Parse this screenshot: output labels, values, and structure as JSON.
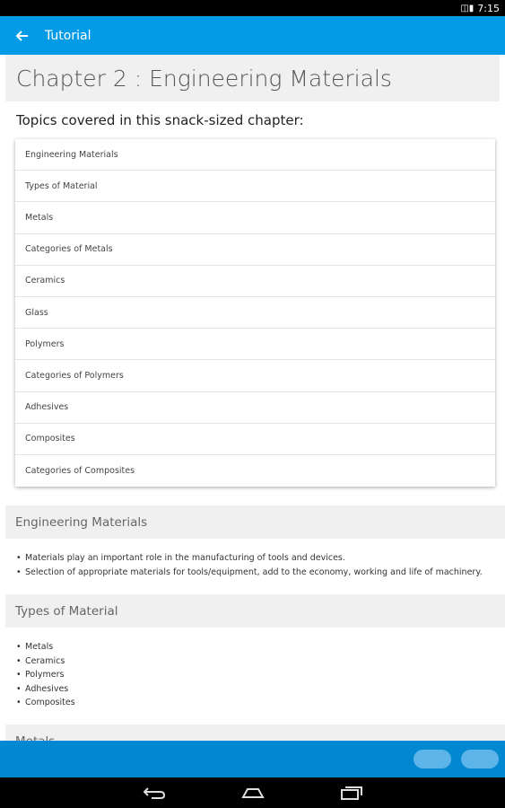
{
  "status_bar": {
    "time": "7:15",
    "signal_icon": "signal-icon"
  },
  "app_bar": {
    "title": "Tutorial",
    "back_icon": "arrow-left-icon"
  },
  "chapter": {
    "title": "Chapter 2 : Engineering Materials",
    "topics_label": "Topics covered in this snack-sized chapter:"
  },
  "topics": [
    "Engineering Materials",
    "Types of Material",
    "Metals",
    "Categories of Metals",
    "Ceramics",
    "Glass",
    "Polymers",
    "Categories of Polymers",
    "Adhesives",
    "Composites",
    "Categories of Composites"
  ],
  "sections": [
    {
      "title": "Engineering Materials",
      "bullets": [
        "Materials play an important role in the manufacturing of tools and devices.",
        "Selection of appropriate materials for tools/equipment, add to the economy, working and life of machinery."
      ]
    },
    {
      "title": "Types of Material",
      "bullets": [
        "Metals",
        "Ceramics",
        "Polymers",
        "Adhesives",
        "Composites"
      ]
    },
    {
      "title": "Metals",
      "bullets": []
    }
  ],
  "colors": {
    "app_bar": "#039be5",
    "bottom_bar": "#0288d1",
    "section_bg": "#f0f0f0"
  }
}
